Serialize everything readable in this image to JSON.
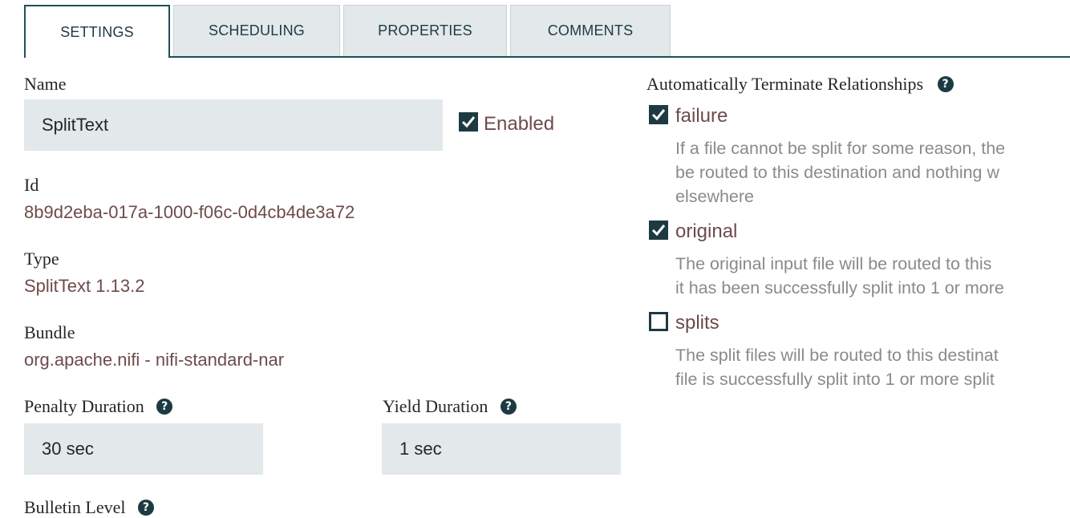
{
  "tabs": [
    {
      "label": "SETTINGS",
      "active": true
    },
    {
      "label": "SCHEDULING",
      "active": false
    },
    {
      "label": "PROPERTIES",
      "active": false
    },
    {
      "label": "COMMENTS",
      "active": false
    }
  ],
  "settings": {
    "name_label": "Name",
    "name_value": "SplitText",
    "enabled_label": "Enabled",
    "enabled_checked": true,
    "id_label": "Id",
    "id_value": "8b9d2eba-017a-1000-f06c-0d4cb4de3a72",
    "type_label": "Type",
    "type_value": "SplitText 1.13.2",
    "bundle_label": "Bundle",
    "bundle_value": "org.apache.nifi - nifi-standard-nar",
    "penalty_label": "Penalty Duration",
    "penalty_value": "30 sec",
    "yield_label": "Yield Duration",
    "yield_value": "1 sec",
    "bulletin_label": "Bulletin Level"
  },
  "relationships": {
    "title": "Automatically Terminate Relationships",
    "items": [
      {
        "name": "failure",
        "checked": true,
        "desc_lines": [
          "If a file cannot be split for some reason, the",
          "be routed to this destination and nothing w",
          "elsewhere"
        ]
      },
      {
        "name": "original",
        "checked": true,
        "desc_lines": [
          "The original input file will be routed to this",
          "it has been successfully split into 1 or more"
        ]
      },
      {
        "name": "splits",
        "checked": false,
        "desc_lines": [
          "The split files will be routed to this destinat",
          "file is successfully split into 1 or more split"
        ]
      }
    ]
  },
  "icons": {
    "help": "question-circle-icon",
    "check": "checkmark-icon"
  },
  "colors": {
    "accent": "#1d3a43",
    "value_text": "#6e4b4b",
    "input_bg": "#e3e8eb",
    "desc_text": "#8a8a8a"
  }
}
